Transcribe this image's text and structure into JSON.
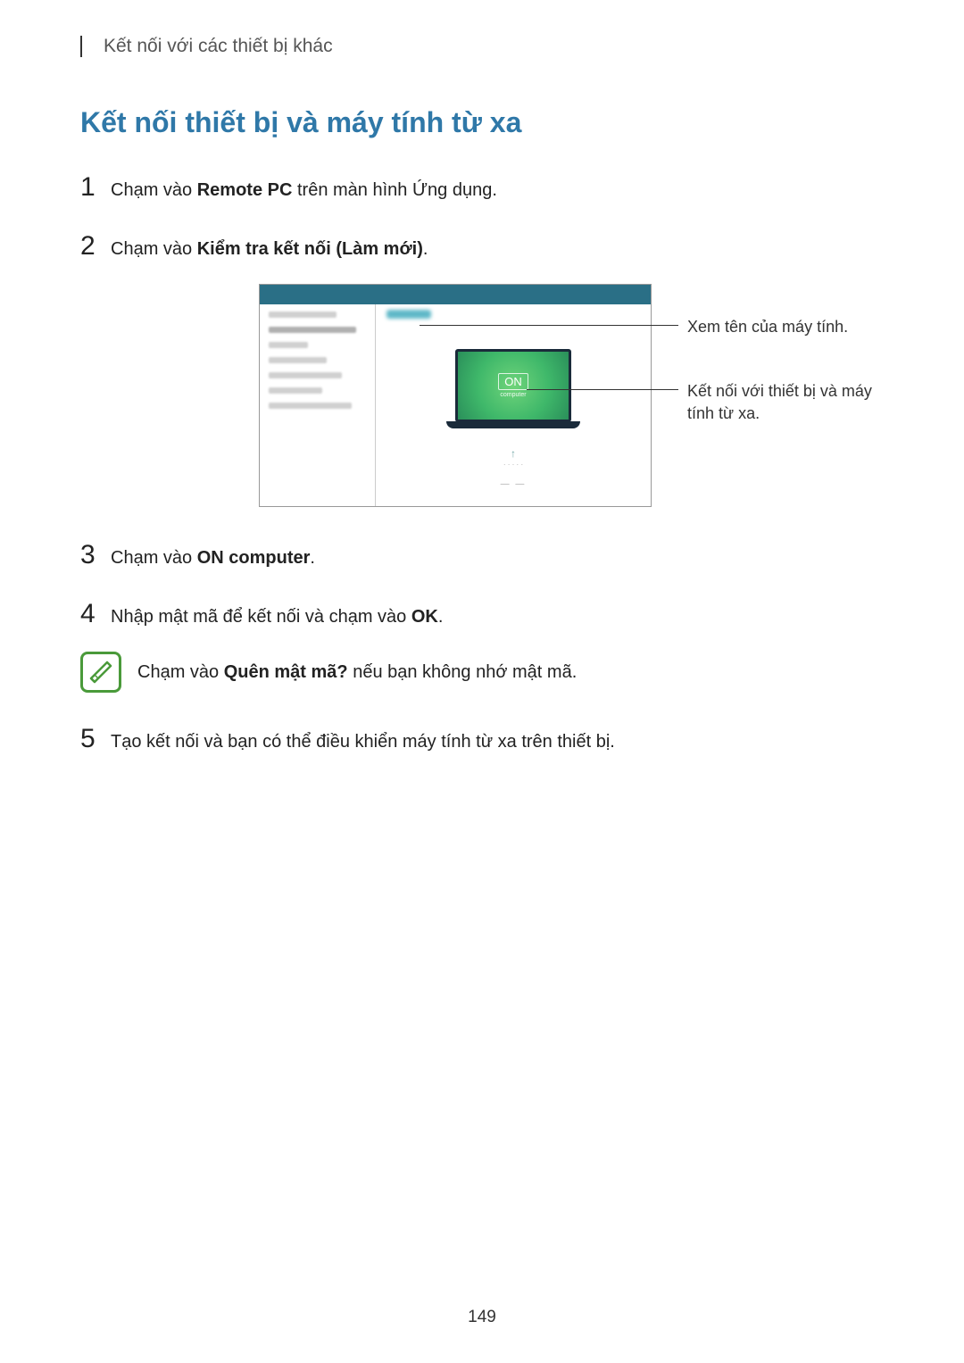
{
  "breadcrumb": "Kết nối với các thiết bị khác",
  "title": "Kết nối thiết bị và máy tính từ xa",
  "steps": {
    "s1": {
      "pre": "Chạm vào ",
      "bold": "Remote PC",
      "post": " trên màn hình Ứng dụng."
    },
    "s2": {
      "pre": "Chạm vào ",
      "bold": "Kiểm tra kết nối (Làm mới)",
      "post": "."
    },
    "s3": {
      "pre": "Chạm vào ",
      "bold": "ON computer",
      "post": "."
    },
    "s4": {
      "pre": "Nhập mật mã để kết nối và chạm vào ",
      "bold": "OK",
      "post": "."
    },
    "s5": {
      "text": "Tạo kết nối và bạn có thể điều khiển máy tính từ xa trên thiết bị."
    }
  },
  "note": {
    "pre": "Chạm vào ",
    "bold": "Quên mật mã?",
    "post": " nếu bạn không nhớ mật mã."
  },
  "callouts": {
    "c1": "Xem tên của máy tính.",
    "c2": "Kết nối với thiết bị và máy tính từ xa."
  },
  "figure": {
    "on_label": "ON",
    "on_sub": "computer"
  },
  "page_number": "149"
}
